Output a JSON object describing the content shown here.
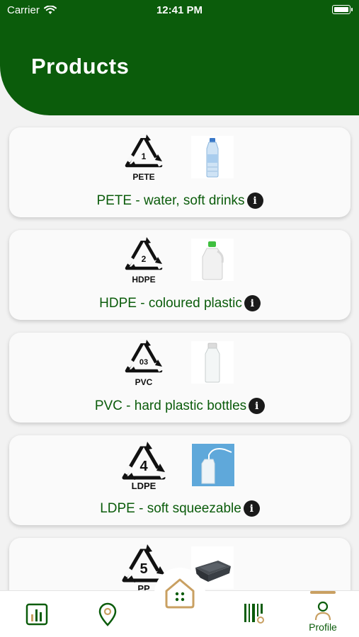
{
  "status_bar": {
    "carrier": "Carrier",
    "time": "12:41 PM"
  },
  "header": {
    "title": "Products"
  },
  "products": [
    {
      "code": "1",
      "abbr": "PETE",
      "label": "PETE - water, soft drinks",
      "photo": "water-bottle"
    },
    {
      "code": "2",
      "abbr": "HDPE",
      "label": "HDPE - coloured plastic",
      "photo": "green-cap-jug"
    },
    {
      "code": "03",
      "abbr": "PVC",
      "label": "PVC - hard plastic bottles",
      "photo": "clear-bottle"
    },
    {
      "code": "4",
      "abbr": "LDPE",
      "label": "LDPE - soft squeezable",
      "photo": "squeeze-bottle"
    },
    {
      "code": "5",
      "abbr": "PP",
      "label": "",
      "photo": "food-container"
    }
  ],
  "tabbar": {
    "items": [
      {
        "icon": "stats-chart-icon",
        "label": ""
      },
      {
        "icon": "map-pin-icon",
        "label": ""
      },
      {
        "icon": "home-icon",
        "label": ""
      },
      {
        "icon": "barcode-scan-icon",
        "label": ""
      },
      {
        "icon": "profile-icon",
        "label": "Profile"
      }
    ]
  },
  "colors": {
    "brand_green": "#0b5c0b",
    "accent_gold": "#c9a062"
  }
}
